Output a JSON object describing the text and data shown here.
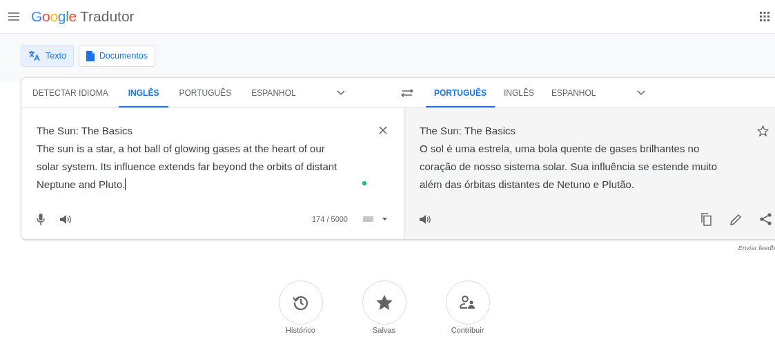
{
  "header": {
    "logo": "Google",
    "app_name": "Tradutor"
  },
  "modes": [
    {
      "label": "Texto",
      "kind": "text",
      "selected": true
    },
    {
      "label": "Documentos",
      "kind": "document",
      "selected": false
    }
  ],
  "source_languages": [
    {
      "label": "DETECTAR IDIOMA",
      "selected": false
    },
    {
      "label": "INGLÊS",
      "selected": true
    },
    {
      "label": "PORTUGUÊS",
      "selected": false
    },
    {
      "label": "ESPANHOL",
      "selected": false
    }
  ],
  "target_languages": [
    {
      "label": "PORTUGUÊS",
      "selected": true
    },
    {
      "label": "INGLÊS",
      "selected": false
    },
    {
      "label": "ESPANHOL",
      "selected": false
    }
  ],
  "source": {
    "lines": [
      "The Sun: The Basics",
      "The sun is a star, a hot ball of glowing gases at the heart of our",
      "solar system. Its influence extends far beyond the orbits of distant",
      "Neptune and Pluto."
    ],
    "char_count": "174 / 5000"
  },
  "translation": {
    "lines": [
      "The Sun: The Basics",
      "O sol é uma estrela, uma bola quente de gases brilhantes no",
      "coração de nosso sistema solar. Sua influência se estende muito",
      "além das órbitas distantes de Netuno e Plutão."
    ]
  },
  "feedback": "Enviar feedb",
  "shortcuts": [
    {
      "label": "Histórico",
      "kind": "history"
    },
    {
      "label": "Salvas",
      "kind": "saved"
    },
    {
      "label": "Contribuir",
      "kind": "contribute"
    }
  ]
}
